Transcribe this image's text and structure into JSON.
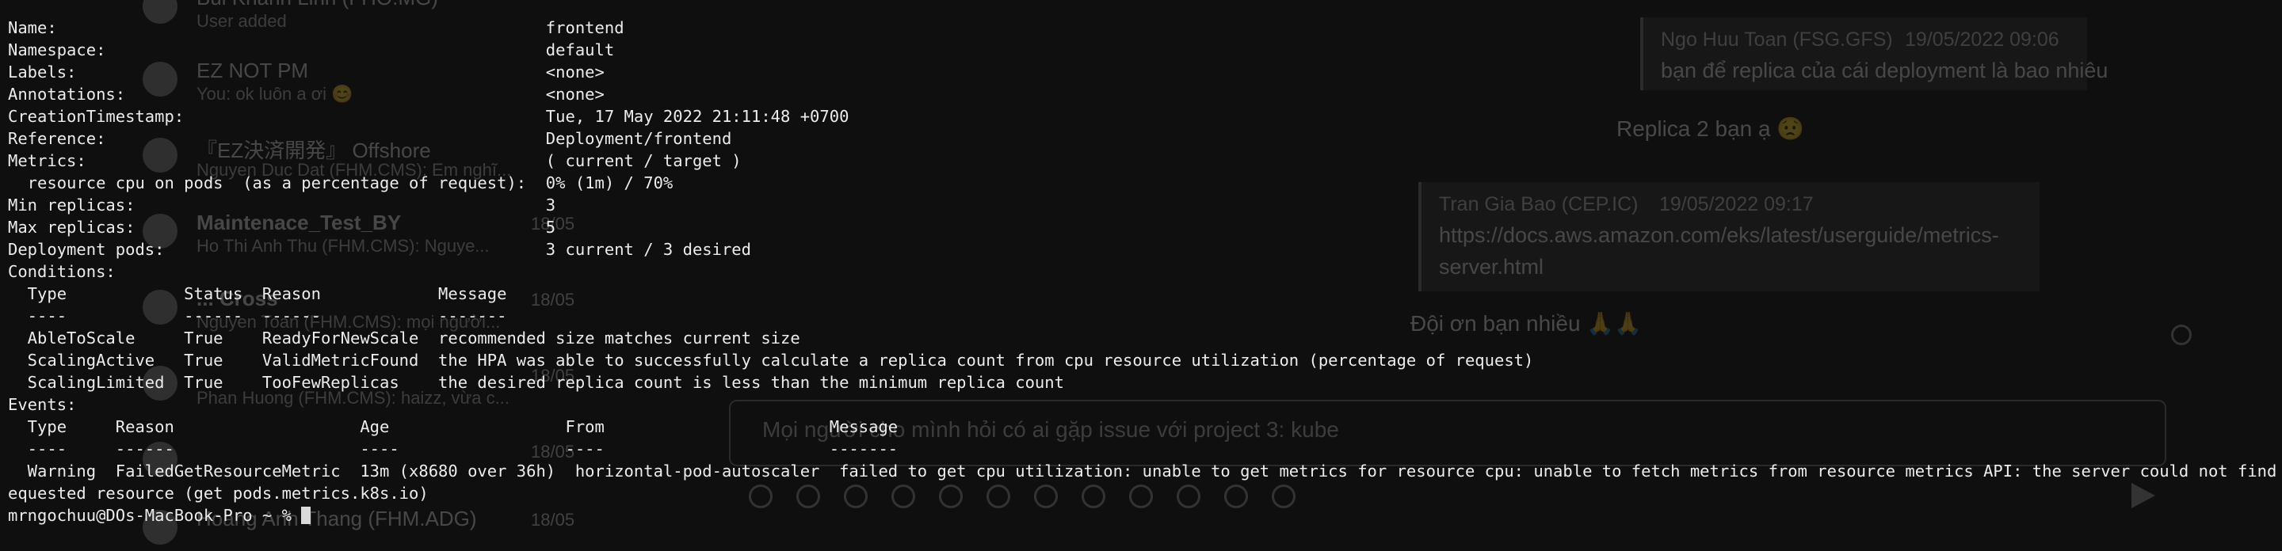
{
  "background_app": {
    "conversations": [
      {
        "name": "Bui Khanh Linh (FHO.MG)",
        "preview": "User added",
        "date": ""
      },
      {
        "name": "EZ NOT PM",
        "preview": "You: ok luôn a ơi 😊",
        "date": ""
      },
      {
        "name": "『EZ決済開発』 Offshore",
        "preview": "Nguyen Duc Dat (FHM.CMS): Em nghĩ...",
        "date": ""
      },
      {
        "name": "Maintenace_Test_BY",
        "preview": "Ho Thi Anh Thu (FHM.CMS): Nguye...",
        "date": "18/05"
      },
      {
        "name": "... Cross",
        "preview": "Nguyen Toan (FHM.CMS): mọi người...",
        "date": "18/05"
      },
      {
        "name": "",
        "preview": "Phan Huong (FHM.CMS): haizz, vừa c...",
        "date": "18/05"
      },
      {
        "name": "",
        "preview": "",
        "date": "18/05"
      },
      {
        "name": "Hoang Anh Thang (FHM.ADG)",
        "preview": "",
        "date": "18/05"
      }
    ],
    "chat": {
      "quote1_author": "Ngo Huu Toan (FSG.GFS)",
      "quote1_time": "19/05/2022 09:06",
      "quote1_text": "bạn để replica của cái deployment là bao nhiêu",
      "reply1": "Replica 2 bạn ạ 😟",
      "quote2_author": "Tran Gia Bao (CEP.IC)",
      "quote2_time": "19/05/2022 09:17",
      "quote2_text_line1": "https://docs.aws.amazon.com/eks/latest/userguide/metrics-",
      "quote2_text_line2": "server.html",
      "reply2": "Đội ơn bạn nhiều 🙏🙏",
      "compose_text": "Mọi người cho mình hỏi có ai gặp issue với project 3: kube"
    }
  },
  "terminal": {
    "lines": [
      "Name:                                                  frontend",
      "Namespace:                                             default",
      "Labels:                                                <none>",
      "Annotations:                                           <none>",
      "CreationTimestamp:                                     Tue, 17 May 2022 21:11:48 +0700",
      "Reference:                                             Deployment/frontend",
      "Metrics:                                               ( current / target )",
      "  resource cpu on pods  (as a percentage of request):  0% (1m) / 70%",
      "Min replicas:                                          3",
      "Max replicas:                                          5",
      "Deployment pods:                                       3 current / 3 desired",
      "Conditions:",
      "  Type            Status  Reason            Message",
      "  ----            ------  ------            -------",
      "  AbleToScale     True    ReadyForNewScale  recommended size matches current size",
      "  ScalingActive   True    ValidMetricFound  the HPA was able to successfully calculate a replica count from cpu resource utilization (percentage of request)",
      "  ScalingLimited  True    TooFewReplicas    the desired replica count is less than the minimum replica count",
      "Events:",
      "  Type     Reason                   Age                  From                       Message",
      "  ----     ------                   ----                 ----                       -------",
      "  Warning  FailedGetResourceMetric  13m (x8680 over 36h)  horizontal-pod-autoscaler  failed to get cpu utilization: unable to get metrics for resource cpu: unable to fetch metrics from resource metrics API: the server could not find the r",
      "equested resource (get pods.metrics.k8s.io)"
    ],
    "prompt": "mrngochuu@DOs-MacBook-Pro ~ % "
  }
}
